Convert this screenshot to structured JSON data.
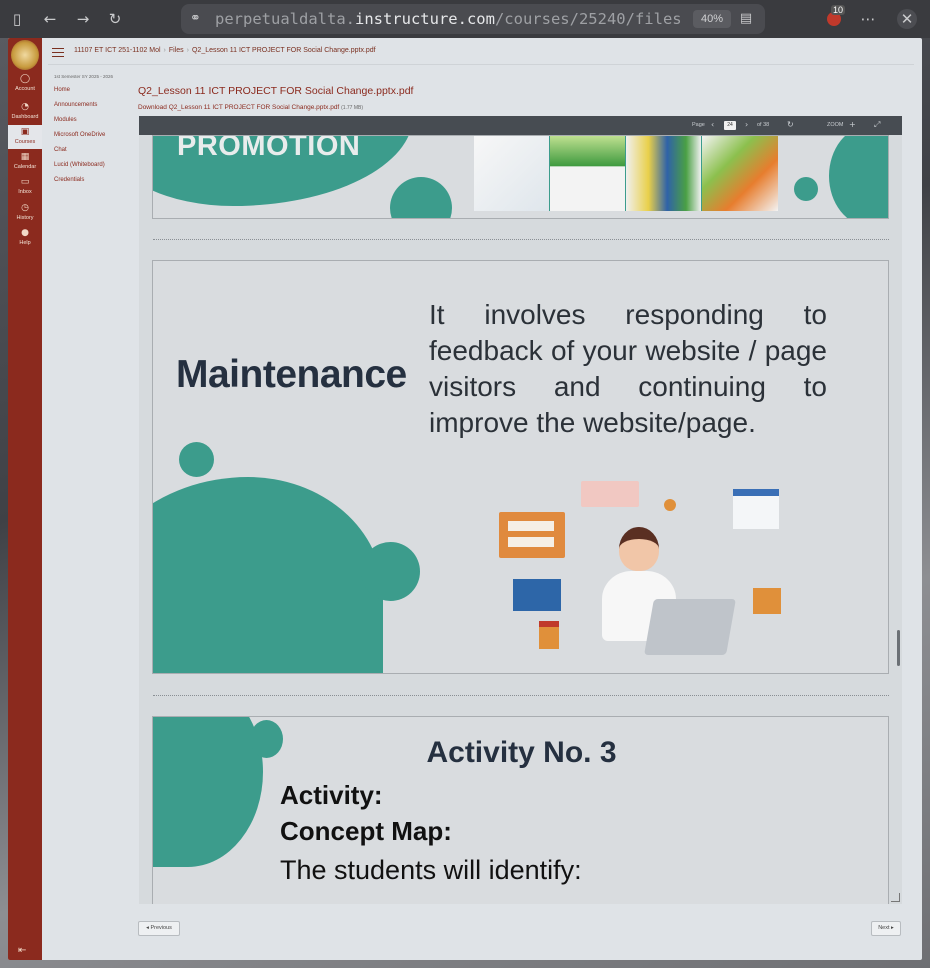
{
  "browser": {
    "url_prefix": "perpetualdalta.",
    "url_host": "instructure.com",
    "url_path": "/courses/25240/files",
    "zoom": "40%",
    "extension_badge": "10"
  },
  "breadcrumb": [
    "11107 ET ICT 251-1102 Mol",
    "Files",
    "Q2_Lesson 11 ICT PROJECT FOR Social Change.pptx.pdf"
  ],
  "global_nav": [
    {
      "label": "Account",
      "icon": "account-icon"
    },
    {
      "label": "Dashboard",
      "icon": "dashboard-icon"
    },
    {
      "label": "Courses",
      "icon": "courses-icon"
    },
    {
      "label": "Calendar",
      "icon": "calendar-icon"
    },
    {
      "label": "Inbox",
      "icon": "inbox-icon"
    },
    {
      "label": "History",
      "icon": "history-icon"
    },
    {
      "label": "Help",
      "icon": "help-icon"
    }
  ],
  "course_nav": {
    "semester": "1st Semester SY 2025 - 2026",
    "items": [
      "Home",
      "Announcements",
      "Modules",
      "Microsoft OneDrive",
      "Chat",
      "Lucid (Whiteboard)",
      "Credentials"
    ]
  },
  "file": {
    "title": "Q2_Lesson 11 ICT PROJECT FOR Social Change.pptx.pdf",
    "download_label": "Download Q2_Lesson 11 ICT PROJECT FOR Social Change.pptx.pdf",
    "size": "(1.77 MB)"
  },
  "viewer": {
    "page_label": "Page",
    "current_page": "24",
    "of_pages": "of 38",
    "zoom_label": "ZOOM"
  },
  "slides": {
    "s1_title": "PROMOTION",
    "s2_heading": "Maintenance",
    "s2_body": "It involves responding to feedback of your website / page visitors and continuing to improve the website/page.",
    "s3_title": "Activity No. 3",
    "s3_line1": "Activity:",
    "s3_line2": "Concept Map:",
    "s3_line3": "The students will identify:"
  },
  "pager": {
    "previous": "◂ Previous",
    "next": "Next ▸"
  },
  "colors": {
    "brand": "#8b2a1e",
    "teal": "#3c9c8c"
  }
}
